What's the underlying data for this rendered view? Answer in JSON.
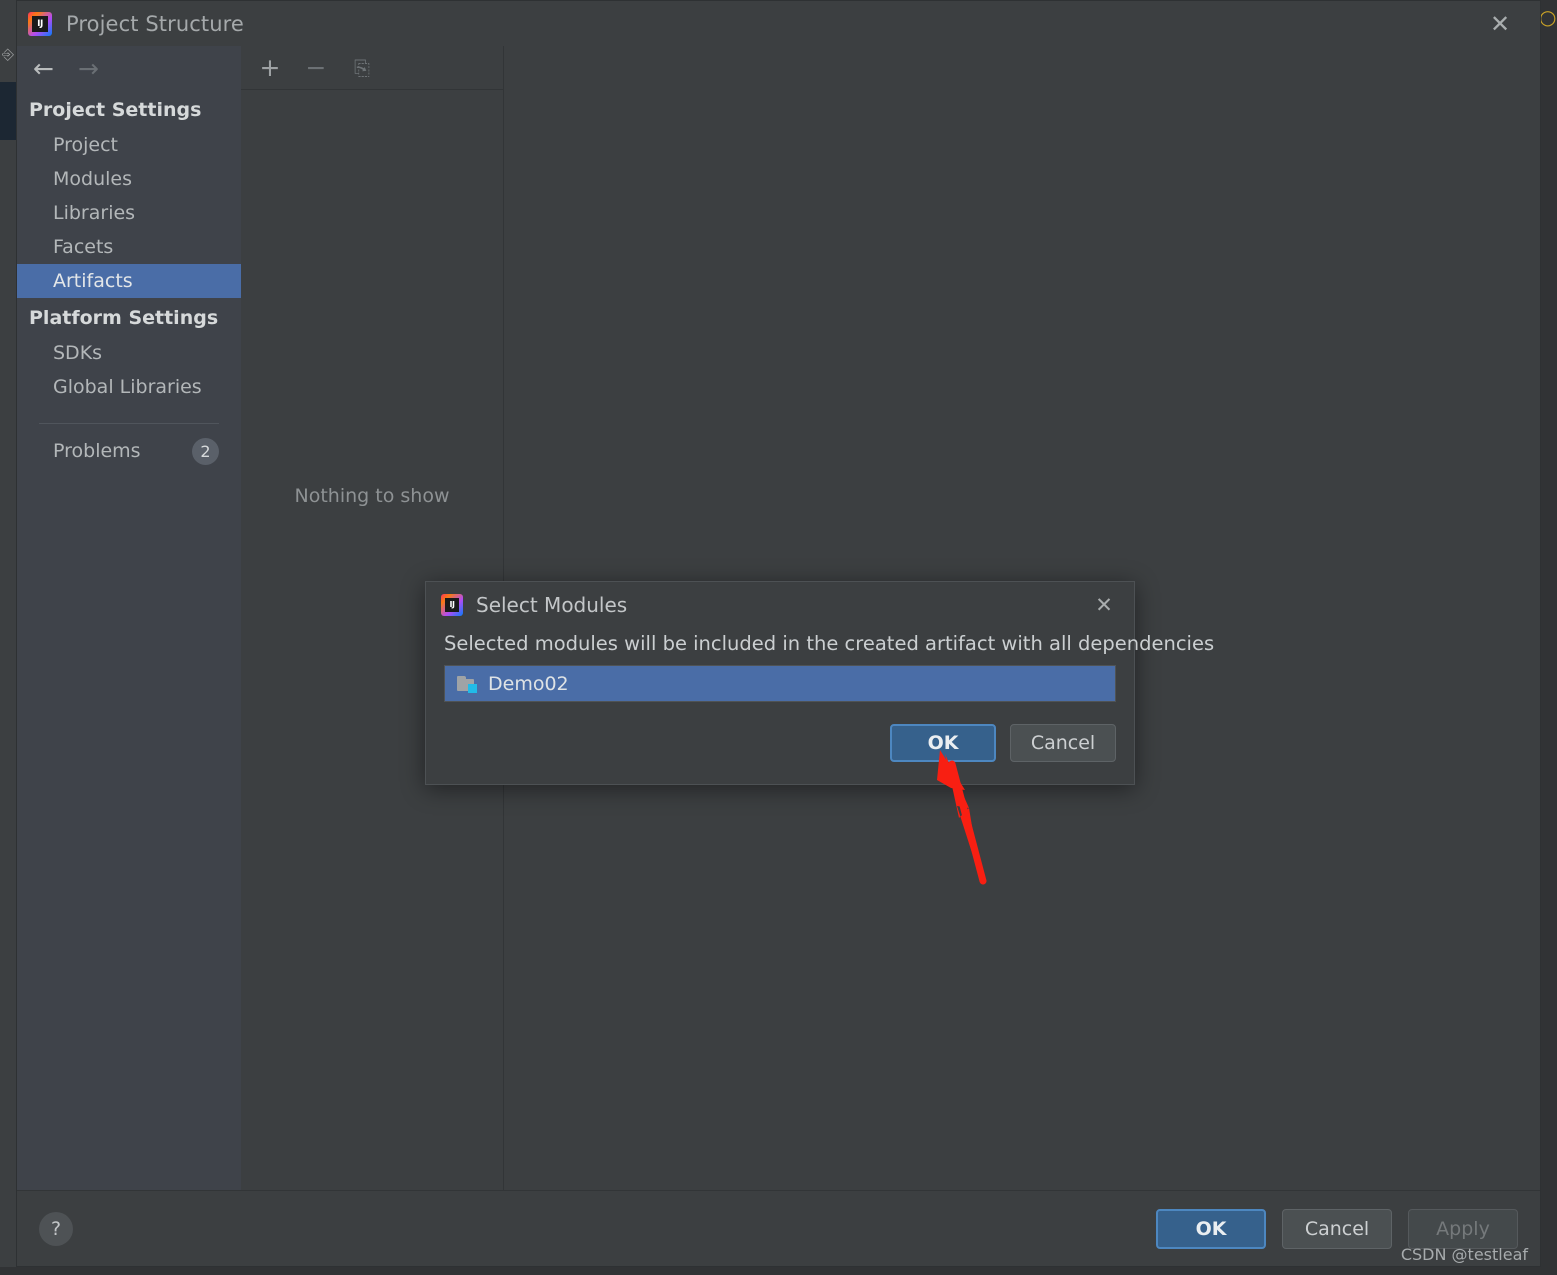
{
  "window": {
    "title": "Project Structure",
    "logo_icon": "intellij-idea-logo",
    "close_icon": "✕"
  },
  "navigation": {
    "back_icon": "←",
    "forward_icon": "→"
  },
  "sidebar": {
    "groups": [
      {
        "heading": "Project Settings",
        "items": [
          {
            "label": "Project",
            "selected": false
          },
          {
            "label": "Modules",
            "selected": false
          },
          {
            "label": "Libraries",
            "selected": false
          },
          {
            "label": "Facets",
            "selected": false
          },
          {
            "label": "Artifacts",
            "selected": true
          }
        ]
      },
      {
        "heading": "Platform Settings",
        "items": [
          {
            "label": "SDKs",
            "selected": false
          },
          {
            "label": "Global Libraries",
            "selected": false
          }
        ]
      }
    ],
    "problems": {
      "label": "Problems",
      "count": "2"
    }
  },
  "artifacts_panel": {
    "toolbar": {
      "add_icon": "+",
      "remove_icon": "−",
      "copy_icon": "⎘"
    },
    "empty_text": "Nothing to show"
  },
  "bottom_bar": {
    "help_icon": "?",
    "ok_label": "OK",
    "cancel_label": "Cancel",
    "apply_label": "Apply"
  },
  "watermark": "CSDN @testleaf",
  "modal": {
    "title": "Select Modules",
    "logo_icon": "intellij-idea-logo",
    "close_icon": "✕",
    "description": "Selected modules will be included in the created artifact with all dependencies",
    "modules": [
      {
        "name": "Demo02",
        "icon": "module-folder-icon",
        "selected": true
      }
    ],
    "ok_label": "OK",
    "cancel_label": "Cancel"
  },
  "annotation": {
    "type": "red-arrow",
    "color": "#f81f12",
    "points_to": "modal-ok-button"
  },
  "colors": {
    "window_bg": "#3c3f41",
    "sidebar_bg": "#3f434a",
    "selection_blue": "#4a6da7",
    "primary_button_blue": "#36618c",
    "text_primary": "#cdd0d2",
    "text_muted": "#8e9294",
    "annotation_red": "#f81f12",
    "module_badge_cyan": "#21bbe8"
  }
}
